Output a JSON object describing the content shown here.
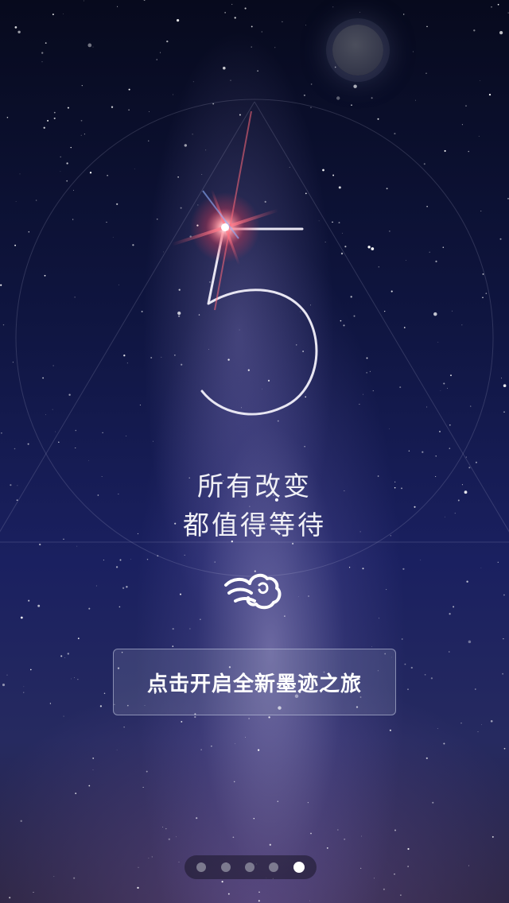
{
  "splash": {
    "countdown_number": "5",
    "headline_line1": "所有改变",
    "headline_line2": "都值得等待",
    "logo_icon": "cloud-swirl-icon",
    "start_button_label": "点击开启全新墨迹之旅"
  },
  "pager": {
    "total_pages": 5,
    "active_page": 5
  },
  "colors": {
    "sky_top": "#070a1d",
    "sky_mid": "#1a2060",
    "text": "#f1f1f6",
    "flare": "#ff5a6a"
  }
}
